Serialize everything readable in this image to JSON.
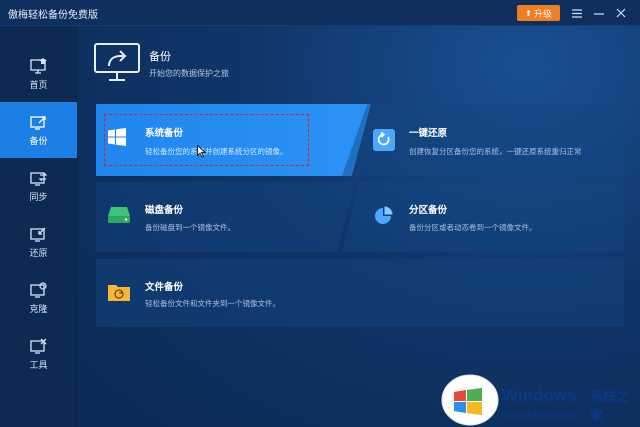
{
  "window": {
    "title": "傲梅轻松备份免费版",
    "upgrade_label": "升级"
  },
  "sidebar": {
    "items": [
      {
        "label": "首页",
        "icon": "home-monitor-icon",
        "active": false
      },
      {
        "label": "备份",
        "icon": "backup-icon",
        "active": true
      },
      {
        "label": "同步",
        "icon": "sync-icon",
        "active": false
      },
      {
        "label": "还原",
        "icon": "restore-icon",
        "active": false
      },
      {
        "label": "克隆",
        "icon": "clone-icon",
        "active": false
      },
      {
        "label": "工具",
        "icon": "tools-icon",
        "active": false
      }
    ]
  },
  "header": {
    "title": "备份",
    "subtitle": "开始您的数据保护之旅"
  },
  "cards": {
    "system": {
      "title": "系统备份",
      "desc": "轻松备份您的系统并创建系统分区的镜像。",
      "icon": "windows-icon"
    },
    "one_key": {
      "title": "一键还原",
      "desc": "创建恢复分区备份您的系统，一键还原系统重归正常",
      "icon": "one-key-restore-icon"
    },
    "disk": {
      "title": "磁盘备份",
      "desc": "备份磁盘到一个镜像文件。",
      "icon": "disk-icon"
    },
    "partition": {
      "title": "分区备份",
      "desc": "备份分区或者动态卷到一个镜像文件。",
      "icon": "partition-icon"
    },
    "file": {
      "title": "文件备份",
      "desc": "轻松备份文件和文件夹到一个镜像文件。",
      "icon": "folder-icon"
    }
  },
  "colors": {
    "accent": "#1c7fe6",
    "upgrade": "#ef7d22",
    "highlight_border": "#e02020"
  },
  "watermark": {
    "brand": "Windows",
    "brand_cn": "系统之家",
    "url": "www.bjjmlv.com"
  }
}
